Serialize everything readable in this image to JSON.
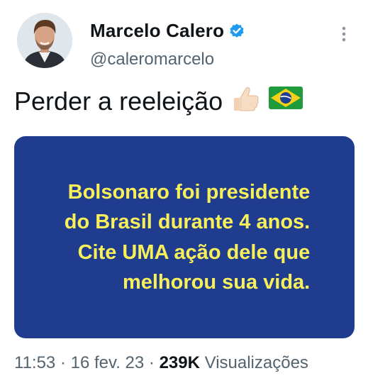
{
  "author": {
    "name": "Marcelo Calero",
    "handle": "@caleromarcelo",
    "verified": true
  },
  "tweet": {
    "text": "Perder a reeleição",
    "emojis": [
      "thumbs-up-emoji",
      "brazil-flag-emoji"
    ]
  },
  "card": {
    "background": "#1f3c8e",
    "text_color": "#f7f05a",
    "lines": [
      "Bolsonaro foi presidente",
      "do Brasil durante 4 anos.",
      "Cite UMA ação dele que",
      "melhorou sua vida."
    ]
  },
  "meta": {
    "time": "11:53",
    "sep1": " · ",
    "date": "16 fev. 23",
    "sep2": " · ",
    "views_count": "239K",
    "views_label": " Visualizações"
  },
  "colors": {
    "verified": "#1d9bf0",
    "secondary_text": "#536471"
  }
}
